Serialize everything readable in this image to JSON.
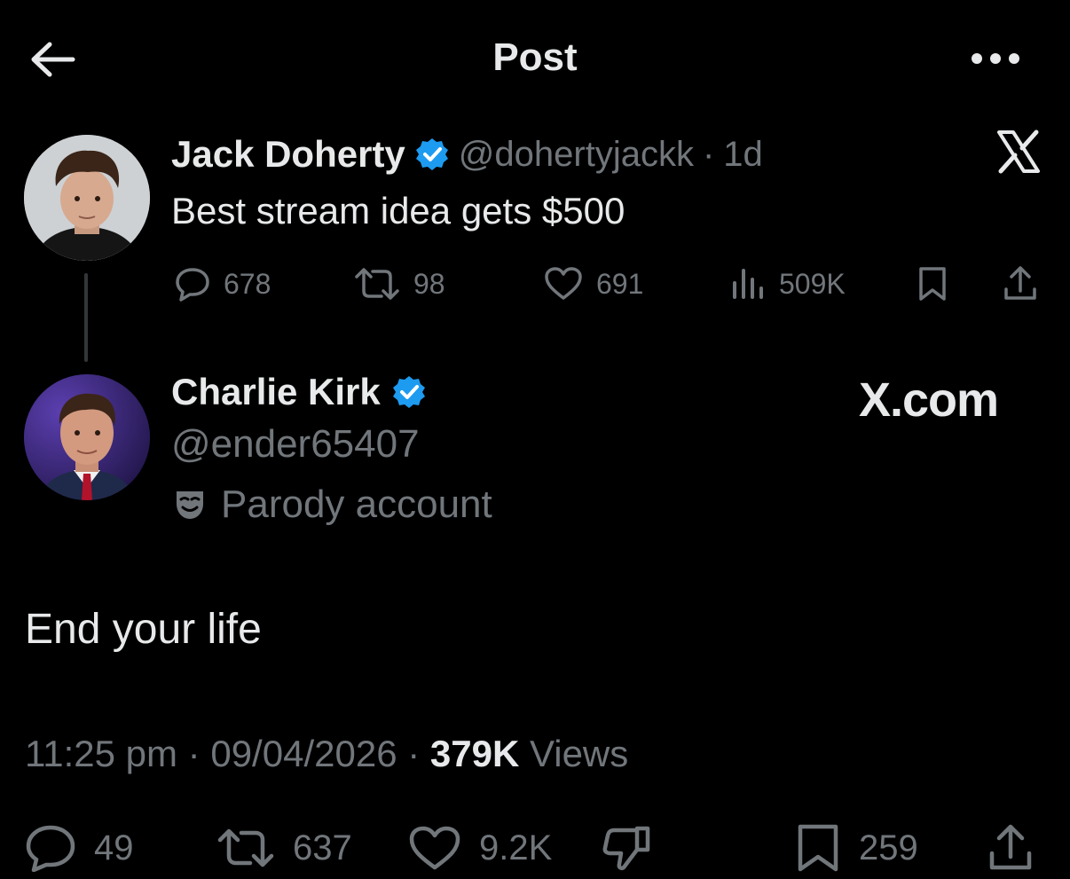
{
  "header": {
    "title": "Post",
    "back_icon": "arrow-left-icon",
    "more_icon": "more-horizontal-icon"
  },
  "parent_post": {
    "display_name": "Jack Doherty",
    "handle": "@dohertyjackk",
    "separator": "·",
    "age": "1d",
    "text": "Best stream idea gets $500",
    "stats": {
      "replies": "678",
      "reposts": "98",
      "likes": "691",
      "views": "509K"
    }
  },
  "reply_post": {
    "display_name": "Charlie Kirk",
    "handle": "@ender65407",
    "label": "Parody account",
    "text": "End your life",
    "time": "11:25 pm",
    "date": "09/04/2026",
    "sep1": "·",
    "sep2": "·",
    "views_count": "379K",
    "views_label": "Views",
    "stats": {
      "replies": "49",
      "reposts": "637",
      "likes": "9.2K",
      "bookmarks": "259"
    }
  },
  "watermark": {
    "logo_icon": "x-logo-icon",
    "text": "X.com"
  },
  "colors": {
    "background": "#000000",
    "text": "#e7e9ea",
    "muted": "#71767b",
    "verified": "#1d9bf0",
    "line": "#333639"
  }
}
